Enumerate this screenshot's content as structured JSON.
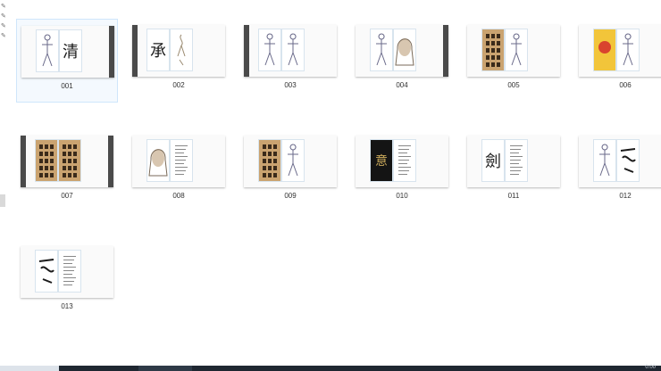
{
  "files": [
    {
      "name": "001",
      "selected": true,
      "layout": "band-right",
      "p1": "figure",
      "p2": "calligraphy",
      "glyph": "清"
    },
    {
      "name": "002",
      "selected": false,
      "layout": "band-left",
      "p1": "calligraphy",
      "p2": "sketch",
      "glyph": "承"
    },
    {
      "name": "003",
      "selected": false,
      "layout": "band-left",
      "p1": "figure",
      "p2": "figure",
      "glyph": ""
    },
    {
      "name": "004",
      "selected": false,
      "layout": "band-right",
      "p1": "figure",
      "p2": "portrait",
      "glyph": ""
    },
    {
      "name": "005",
      "selected": false,
      "layout": "none",
      "p1": "tan-text",
      "p2": "figure",
      "glyph": ""
    },
    {
      "name": "006",
      "selected": false,
      "layout": "none",
      "p1": "yellow",
      "p2": "figure",
      "glyph": ""
    },
    {
      "name": "007",
      "selected": false,
      "layout": "band-both",
      "p1": "tan-text",
      "p2": "tan-text",
      "glyph": ""
    },
    {
      "name": "008",
      "selected": false,
      "layout": "none",
      "p1": "portrait",
      "p2": "text",
      "glyph": ""
    },
    {
      "name": "009",
      "selected": false,
      "layout": "none",
      "p1": "tan-text",
      "p2": "figure",
      "glyph": ""
    },
    {
      "name": "010",
      "selected": false,
      "layout": "none",
      "p1": "dark",
      "p2": "text",
      "glyph": "意"
    },
    {
      "name": "011",
      "selected": false,
      "layout": "none",
      "p1": "calligraphy",
      "p2": "text",
      "glyph": "劍"
    },
    {
      "name": "012",
      "selected": false,
      "layout": "none",
      "p1": "figure",
      "p2": "calligraphy",
      "glyph": ""
    },
    {
      "name": "013",
      "selected": false,
      "layout": "none",
      "p1": "calligraphy",
      "p2": "text",
      "glyph": ""
    }
  ],
  "taskbar": {
    "clock": "0:00"
  },
  "colors": {
    "selection": "#cfe6fb",
    "band": "#4a4a4a",
    "tan": "#caa370"
  }
}
